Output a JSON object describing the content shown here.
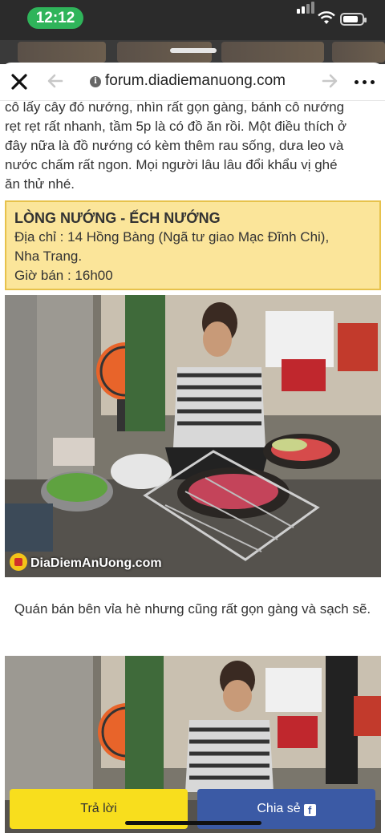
{
  "status_bar": {
    "time": "12:12"
  },
  "browser": {
    "url": "forum.diadiemanuong.com"
  },
  "article": {
    "paragraph_lines": [
      "cô lấy cây đó nướng, nhìn rất gọn gàng, bánh cô nướng",
      "rẹt rẹt rất nhanh, tầm 5p là có đồ ăn rồi. Một điều thích ở",
      "đây nữa là đồ nướng có kèm thêm rau sống, dưa leo và",
      "nước chấm rất ngon. Mọi người lâu lâu đổi khẩu vị ghé",
      "ăn thử nhé."
    ],
    "info_box": {
      "title": "LÒNG NƯỚNG - ẾCH NƯỚNG",
      "address_line1": "Địa chỉ : 14 Hồng Bàng (Ngã tư giao Mạc Đĩnh Chi),",
      "address_line2": "Nha Trang.",
      "hours": "Giờ bán : 16h00"
    },
    "watermark": "DiaDiemAnUong.com",
    "caption": "Quán bán bên vỉa hè nhưng cũng rất gọn gàng và sạch sẽ."
  },
  "actions": {
    "reply_label": "Trả lời",
    "share_label": "Chia sẻ",
    "share_icon": "facebook-icon"
  },
  "colors": {
    "status_clock": "#2fb45a",
    "info_box_bg": "#fbe59a",
    "reply_button": "#f8de1d",
    "share_button": "#3b5aa5"
  }
}
